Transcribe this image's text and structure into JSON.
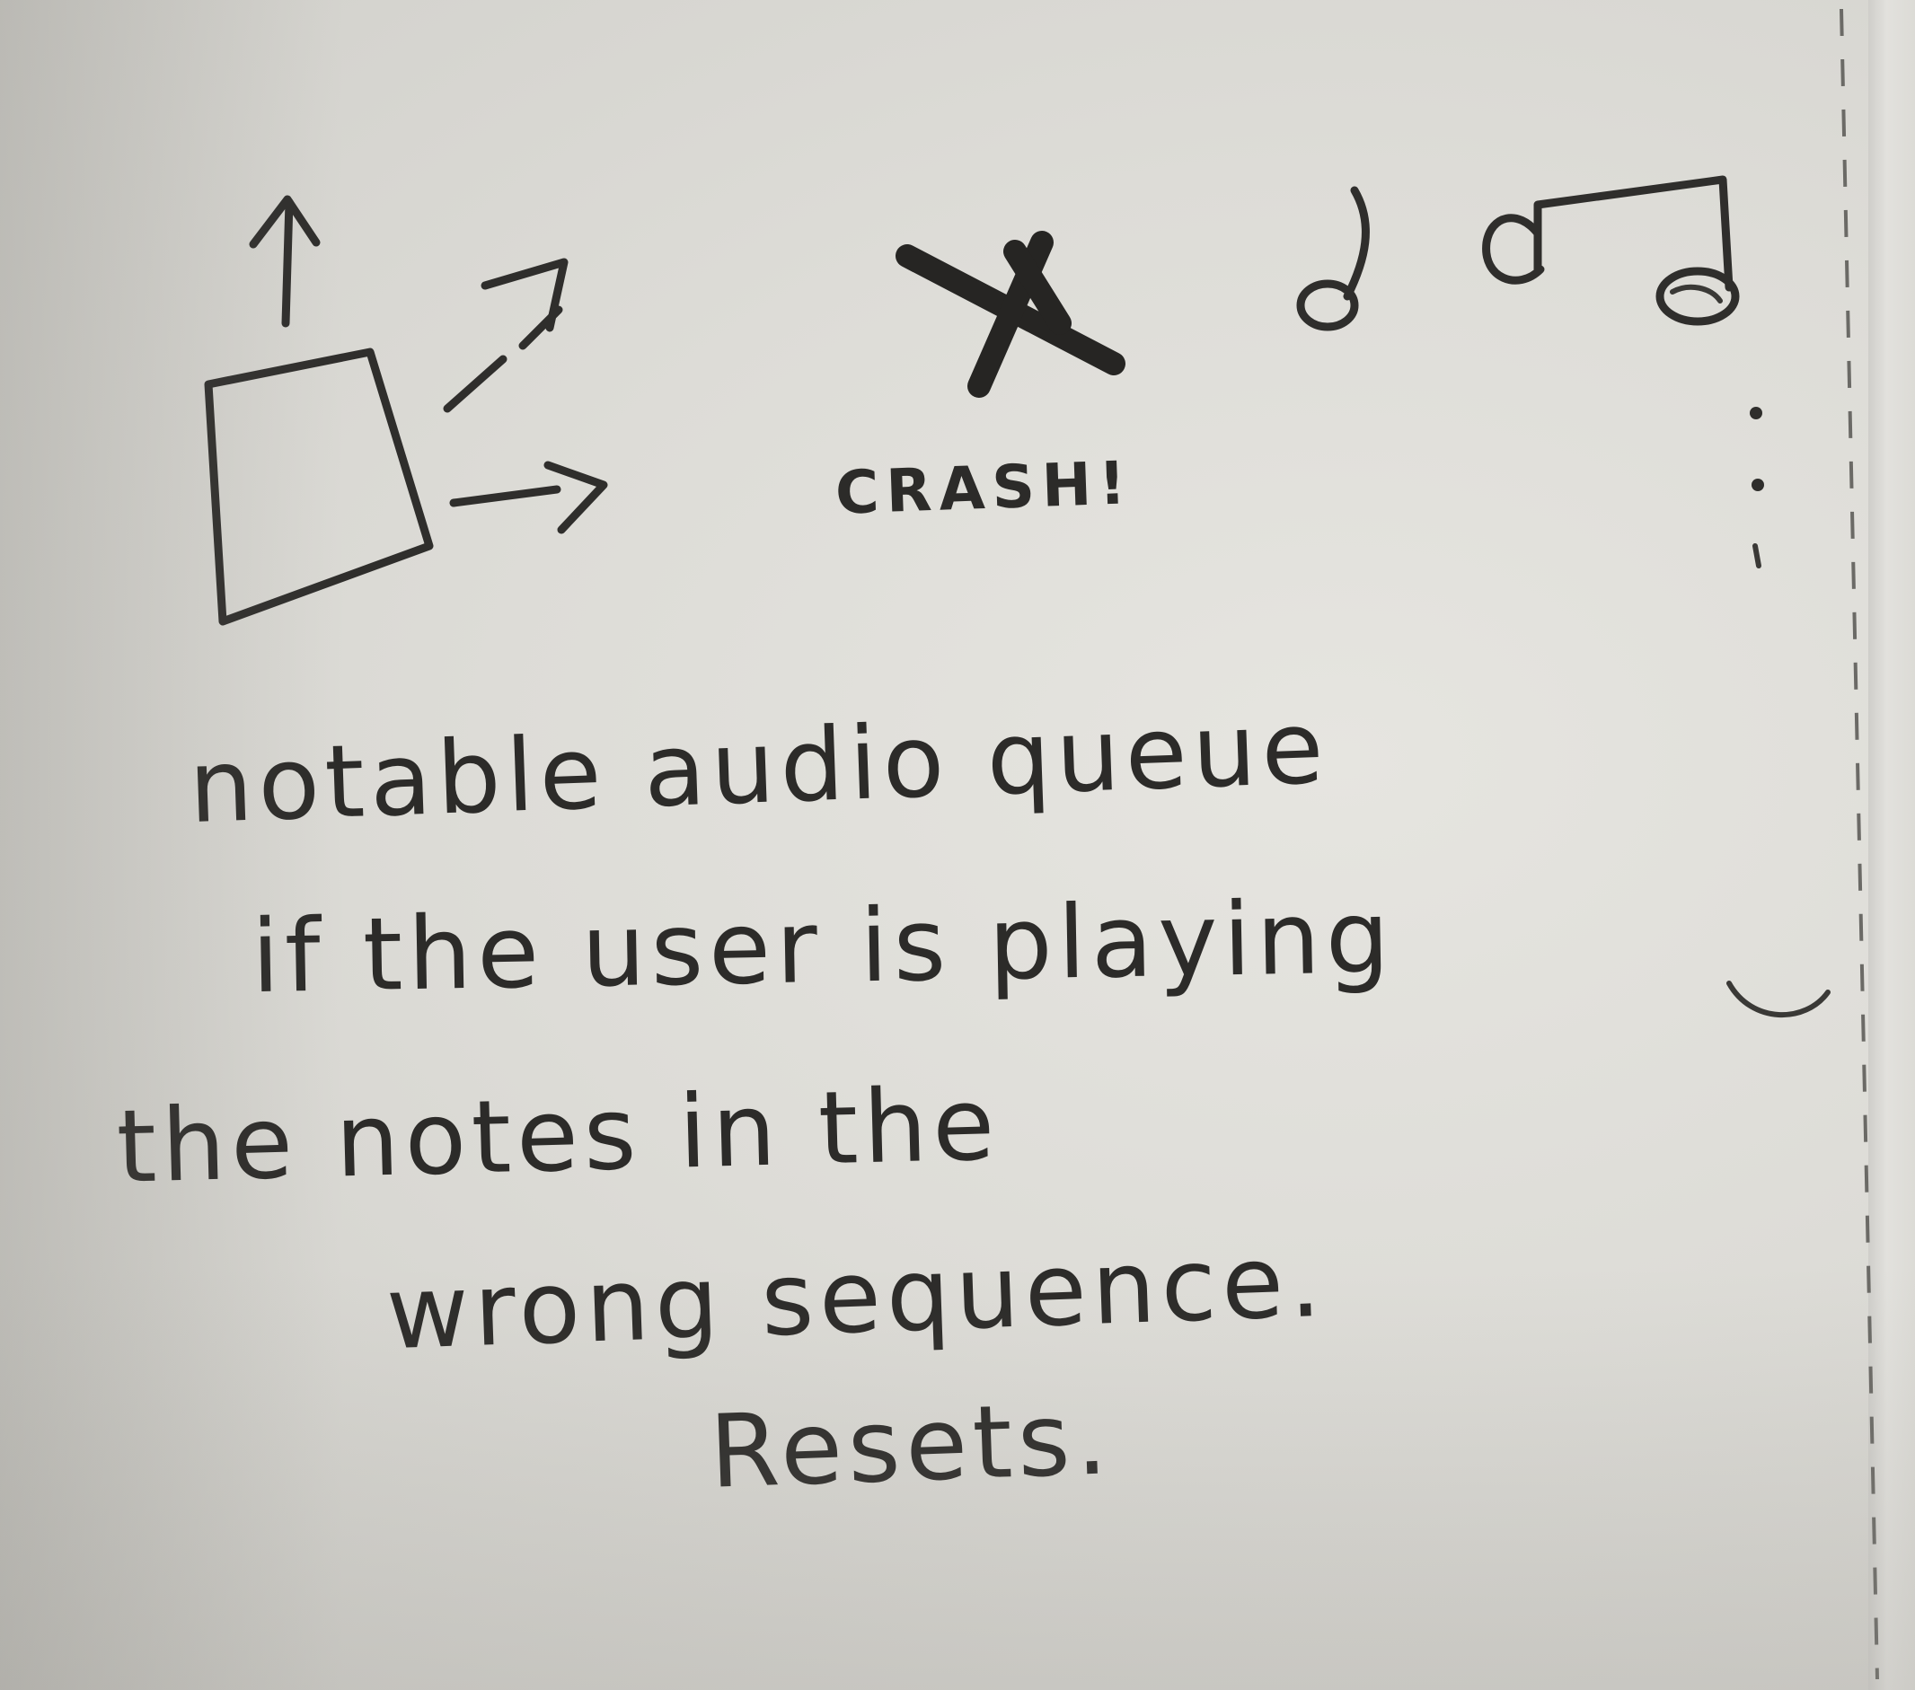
{
  "sketch": {
    "crash_label": "CRASH!",
    "note_lines": [
      "notable audio queue",
      "if the user is playing",
      "the notes in the",
      "wrong sequence.",
      "Resets."
    ]
  },
  "colors": {
    "paper": "#dddcd7",
    "ink": "#2f2e2c"
  },
  "icons": [
    "box-with-arrows-icon",
    "crossed-out-x-icon",
    "music-notes-icon",
    "vertical-dots-icon"
  ]
}
